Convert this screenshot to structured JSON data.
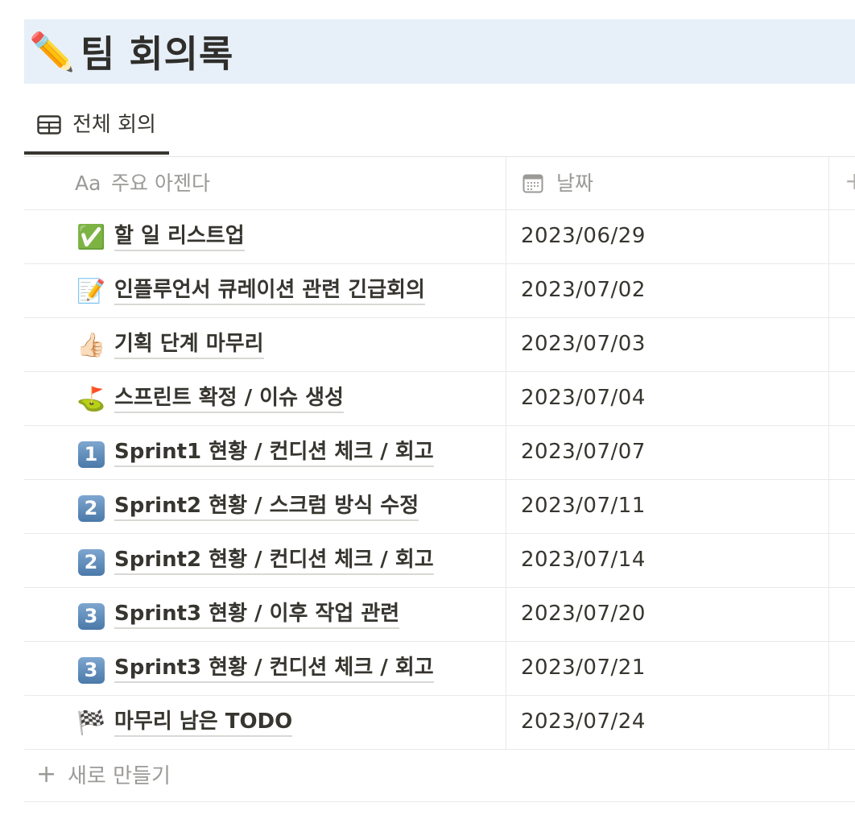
{
  "page": {
    "icon": "✏️",
    "icon_name": "pencil-icon",
    "title": "팀 회의록"
  },
  "tabs": [
    {
      "label": "전체 회의",
      "icon": "table-icon",
      "active": true
    }
  ],
  "table": {
    "columns": {
      "title": {
        "icon_text": "Aa",
        "label": "주요 아젠다"
      },
      "date": {
        "icon": "calendar-icon",
        "label": "날짜"
      },
      "add": {
        "symbol": "+"
      }
    },
    "rows": [
      {
        "emoji": "✅",
        "emoji_name": "check-mark-icon",
        "title": "할 일 리스트업",
        "date": "2023/06/29"
      },
      {
        "emoji": "📝",
        "emoji_name": "memo-icon",
        "title": "인플루언서 큐레이션 관련 긴급회의",
        "date": "2023/07/02"
      },
      {
        "emoji": "👍🏻",
        "emoji_name": "thumbs-up-icon",
        "title": "기획 단계 마무리",
        "date": "2023/07/03"
      },
      {
        "emoji": "⛳",
        "emoji_name": "golf-flag-icon",
        "title": "스프린트 확정 / 이슈 생성",
        "date": "2023/07/04"
      },
      {
        "emoji": "1",
        "emoji_name": "keycap-1-icon",
        "title": "Sprint1 현황 / 컨디션 체크 / 회고",
        "date": "2023/07/07"
      },
      {
        "emoji": "2",
        "emoji_name": "keycap-2-icon",
        "title": "Sprint2 현황 / 스크럼 방식 수정",
        "date": "2023/07/11"
      },
      {
        "emoji": "2",
        "emoji_name": "keycap-2-icon",
        "title": "Sprint2 현황 / 컨디션 체크 / 회고",
        "date": "2023/07/14"
      },
      {
        "emoji": "3",
        "emoji_name": "keycap-3-icon",
        "title": "Sprint3 현황 / 이후 작업 관련",
        "date": "2023/07/20"
      },
      {
        "emoji": "3",
        "emoji_name": "keycap-3-icon",
        "title": "Sprint3 현황 / 컨디션 체크 / 회고",
        "date": "2023/07/21"
      },
      {
        "emoji": "🏁",
        "emoji_name": "checkered-flag-icon",
        "title": "마무리 남은 TODO",
        "date": "2023/07/24"
      }
    ],
    "new_row": {
      "symbol": "+",
      "label": "새로 만들기"
    }
  },
  "colors": {
    "title_bg": "#e7f0f8",
    "text": "#37352f",
    "muted": "#9b9a97",
    "divider": "#e9e9e7",
    "badge": "#5b87b5"
  }
}
